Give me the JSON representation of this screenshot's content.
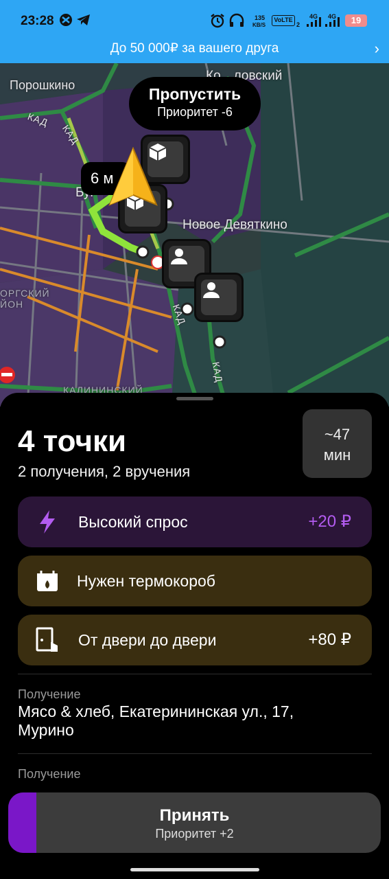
{
  "status_bar": {
    "time": "23:28",
    "speed_value": "135",
    "speed_unit": "KB/S",
    "volte": "VoLTE",
    "sim_slot": "2",
    "net1": "4G",
    "net2": "4G",
    "battery": "19"
  },
  "promo": {
    "text": "До 50 000₽ за вашего друга"
  },
  "map": {
    "labels": {
      "poroshkino": "Порошкино",
      "okhtinsky": "Ко…ловский",
      "kad1": "КАД",
      "kad2": "КАД",
      "kad3": "КАД",
      "kad4": "КАД",
      "bugry": "Буг",
      "devyatkino": "Новое Девяткино",
      "district1": "ОРГСКИЙ",
      "district2": "ЙОН",
      "district3": "КАЛИНИНСКИЙ"
    },
    "skip_bubble": {
      "title": "Пропустить",
      "priority": "Приоритет -6"
    },
    "eta": "6 м"
  },
  "summary": {
    "title": "4 точки",
    "subtitle": "2 получения, 2 вручения",
    "time_value": "~47",
    "time_unit": "мин"
  },
  "badges": [
    {
      "icon": "lightning-icon",
      "label": "Высокий спрос",
      "value": "+20 ₽",
      "color": "#b35cf0"
    },
    {
      "icon": "thermobox-icon",
      "label": "Нужен термокороб",
      "value": ""
    },
    {
      "icon": "door-icon",
      "label": "От двери до двери",
      "value": "+80 ₽"
    }
  ],
  "points": [
    {
      "type": "Получение",
      "address": "Мясо & хлеб, Екатерининская ул., 17, Мурино"
    },
    {
      "type": "Получение"
    }
  ],
  "accept": {
    "label": "Принять",
    "priority": "Приоритет +2"
  }
}
